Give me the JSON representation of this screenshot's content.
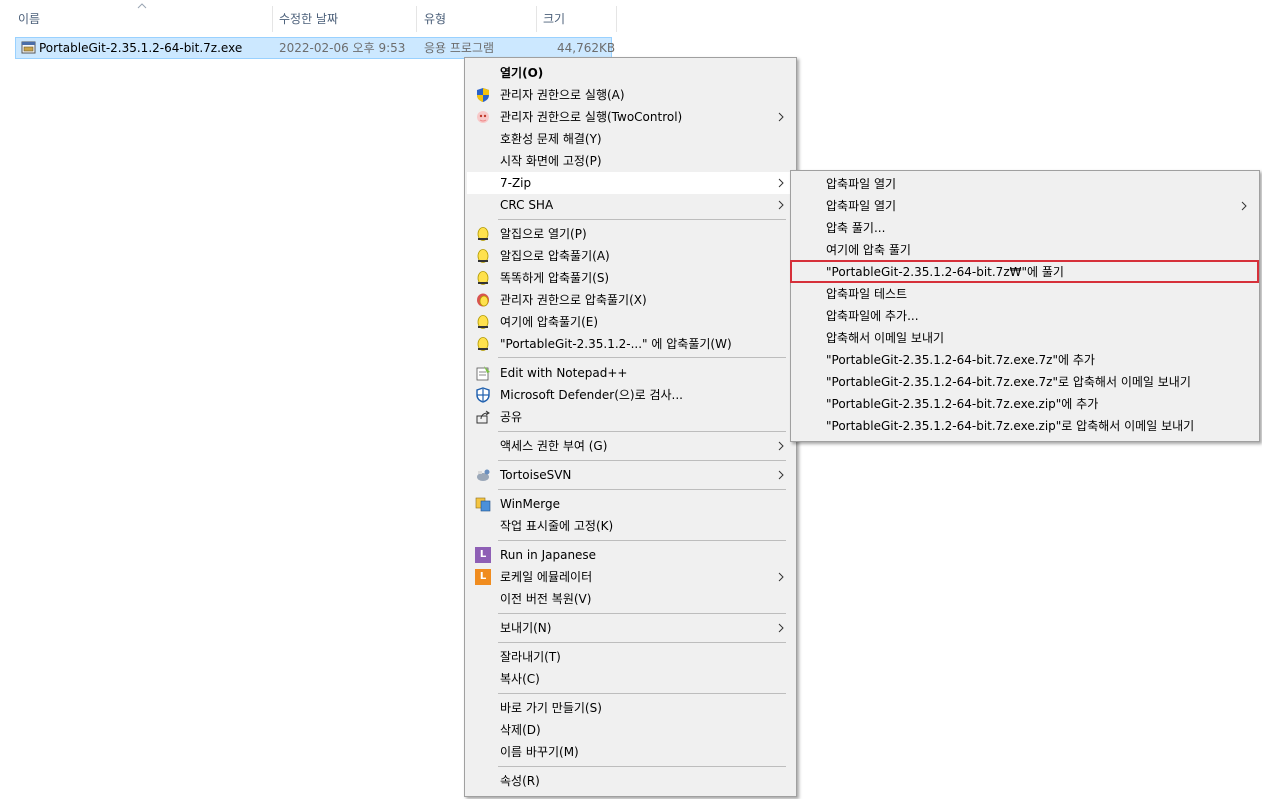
{
  "columns": {
    "name": "이름",
    "modified": "수정한 날짜",
    "type": "유형",
    "size": "크기"
  },
  "file": {
    "name": "PortableGit-2.35.1.2-64-bit.7z.exe",
    "modified": "2022-02-06 오후 9:53",
    "type": "응용 프로그램",
    "size": "44,762KB"
  },
  "menu": {
    "open": "열기(O)",
    "run_as_admin": "관리자 권한으로 실행(A)",
    "run_as_admin_two": "관리자 권한으로 실행(TwoControl)",
    "troubleshoot": "호환성 문제 해결(Y)",
    "pin_start": "시작 화면에 고정(P)",
    "sevenzip": "7-Zip",
    "crc": "CRC SHA",
    "alzip_open": "알집으로 열기(P)",
    "alzip_extract": "알집으로 압축풀기(A)",
    "smart_extract": "똑똑하게 압축풀기(S)",
    "admin_extract": "관리자 권한으로 압축풀기(X)",
    "extract_here": "여기에 압축풀기(E)",
    "extract_to": "\"PortableGit-2.35.1.2-...\" 에 압축풀기(W)",
    "notepad": "Edit with Notepad++",
    "defender": "Microsoft Defender(으)로 검사...",
    "share": "공유",
    "give_access": "액세스 권한 부여 (G)",
    "tortoise": "TortoiseSVN",
    "winmerge": "WinMerge",
    "pin_taskbar": "작업 표시줄에 고정(K)",
    "run_japanese": "Run in Japanese",
    "locale_emulator": "로케일 에뮬레이터",
    "restore": "이전 버전 복원(V)",
    "send_to": "보내기(N)",
    "cut": "잘라내기(T)",
    "copy": "복사(C)",
    "shortcut": "바로 가기 만들기(S)",
    "delete": "삭제(D)",
    "rename": "이름 바꾸기(M)",
    "properties": "속성(R)"
  },
  "submenu": {
    "open_archive": "압축파일 열기",
    "open_archive_more": "압축파일 열기",
    "extract": "압축 풀기...",
    "extract_here": "여기에 압축 풀기",
    "extract_to": "\"PortableGit-2.35.1.2-64-bit.7z₩\"에 풀기",
    "test": "압축파일 테스트",
    "add": "압축파일에 추가...",
    "compress_email": "압축해서 이메일 보내기",
    "add_7z": "\"PortableGit-2.35.1.2-64-bit.7z.exe.7z\"에 추가",
    "email_7z": "\"PortableGit-2.35.1.2-64-bit.7z.exe.7z\"로 압축해서 이메일 보내기",
    "add_zip": "\"PortableGit-2.35.1.2-64-bit.7z.exe.zip\"에 추가",
    "email_zip": "\"PortableGit-2.35.1.2-64-bit.7z.exe.zip\"로 압축해서 이메일 보내기"
  },
  "icons": {
    "run_japanese_letter": "L",
    "locale_letter": "L"
  },
  "colors": {
    "selection": "#cce8ff",
    "highlight_border": "#d6303a",
    "menu_bg": "#f0f0f0"
  }
}
